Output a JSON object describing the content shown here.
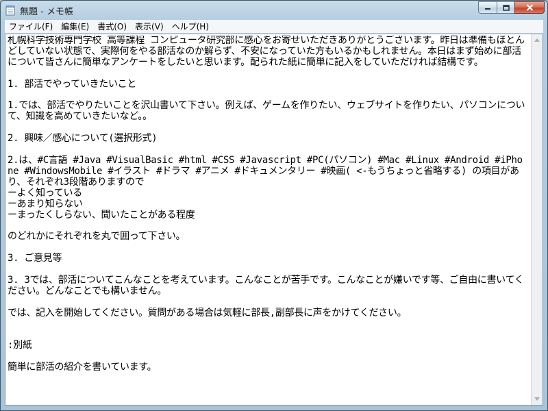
{
  "window": {
    "title": "無題 - メモ帳"
  },
  "menu": [
    {
      "label": "ファイル(F)"
    },
    {
      "label": "編集(E)"
    },
    {
      "label": "書式(O)"
    },
    {
      "label": "表示(V)"
    },
    {
      "label": "ヘルプ(H)"
    }
  ],
  "document": {
    "text": "札幌科学技術専門学校 高等課程 コンピュータ研究部に感心をお寄せいただきありがとうございます。昨日は準備もほとんどしていない状態で、実際何をやる部活なのか解らず、不安になっていた方もいるかもしれません。本日はまず始めに部活について皆さんに簡単なアンケートをしたいと思います。配られた紙に簡単に記入をしていただければ結構です。\n\n1. 部活でやっていきたいこと\n\n1.では、部活でやりたいことを沢山書いて下さい。例えば、ゲームを作りたい、ウェブサイトを作りたい、パソコンについて、知識を高めていきたいなど。。\n\n2. 興味／感心について(選択形式)\n\n2.は、#C言語 #Java #VisualBasic #html #CSS #Javascript #PC(パソコン) #Mac #Linux #Android #iPhone #WindowsMobile #イラスト #ドラマ #アニメ #ドキュメンタリー #映画( <-もうちょっと省略する) の項目があり、それぞれ3段階ありますので\nーよく知っている\nーあまり知らない\nーまったくしらない、聞いたことがある程度\n\nのどれかにそれぞれを丸で囲って下さい。\n\n3. ご意見等\n\n3. 3では、部活についてこんなことを考えています。こんなことが苦手です。こんなことが嫌いです等、ご自由に書いてください。どんなことでも構いません。\n\nでは、記入を開始してください。質問がある場合は気軽に部長,副部長に声をかけてください。\n\n\n:別紙\n\n簡単に部活の紹介を書いています。"
  }
}
